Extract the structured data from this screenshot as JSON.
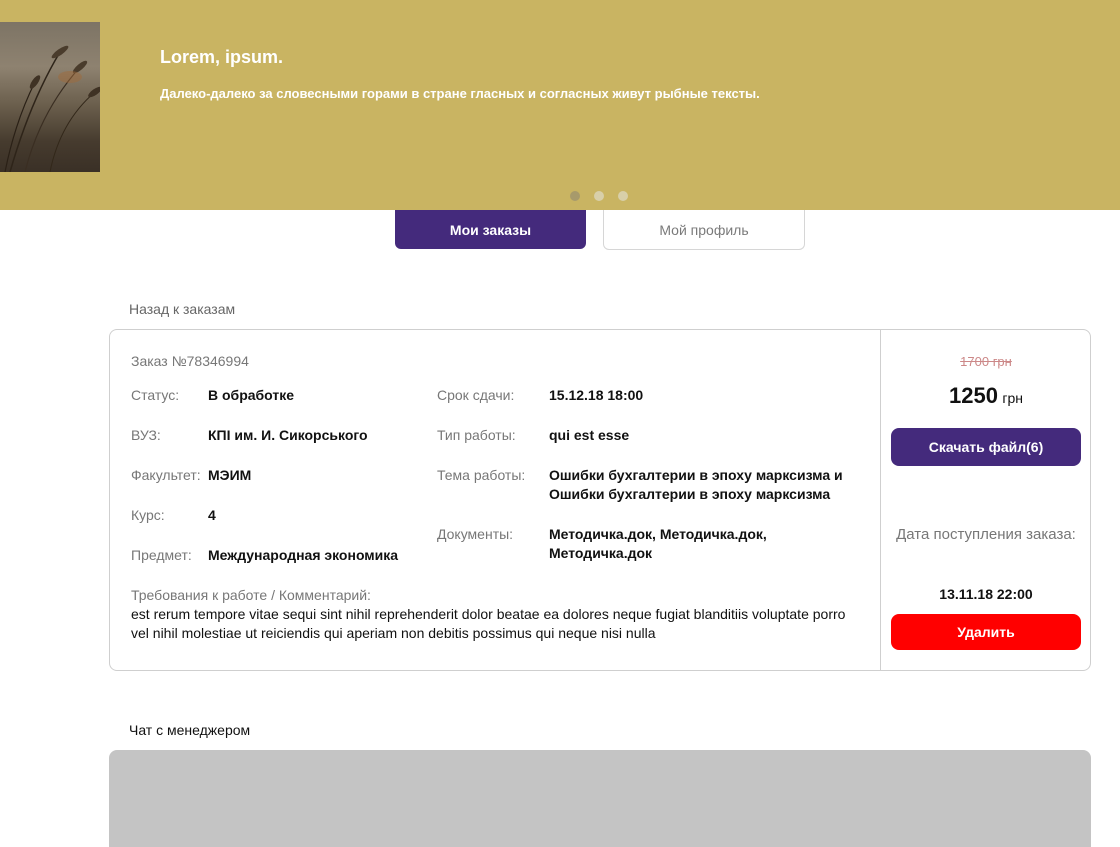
{
  "banner": {
    "title": "Lorem, ipsum.",
    "text": "Далеко-далеко за словесными горами в стране гласных и согласных живут рыбные тексты.",
    "color": "#c9b462",
    "slides": 3,
    "active_slide": 1
  },
  "tabs": {
    "orders": "Мои заказы",
    "profile": "Мой профиль"
  },
  "back_link": "Назад к заказам",
  "order": {
    "number": "Заказ №78346994",
    "left_fields": [
      {
        "label": "Статус:",
        "value": "В обработке"
      },
      {
        "label": "ВУЗ:",
        "value": "КПІ им. И. Сикорського"
      },
      {
        "label": "Факультет:",
        "value": "МЭИМ"
      },
      {
        "label": "Курс:",
        "value": "4"
      },
      {
        "label": "Предмет:",
        "value": "Международная экономика"
      }
    ],
    "right_fields": [
      {
        "label": "Срок сдачи:",
        "value": "15.12.18 18:00"
      },
      {
        "label": "Тип работы:",
        "value": "qui est esse"
      },
      {
        "label": "Тема работы:",
        "value": "Ошибки бухгалтерии в эпоху марксизма и Ошибки бухгалтерии в эпоху марксизма"
      },
      {
        "label": "Документы:",
        "value": "Методичка.док, Методичка.док, Методичка.док"
      }
    ],
    "requirements_label": "Требования к работе / Комментарий:",
    "requirements_text": "est rerum tempore vitae sequi sint nihil reprehenderit dolor beatae ea dolores neque fugiat blanditiis voluptate porro vel nihil molestiae ut reiciendis qui aperiam non debitis possimus qui neque nisi nulla",
    "old_price": "1700 грн",
    "new_price": "1250",
    "currency": "грн",
    "download_button": "Скачать файл(6)",
    "date_label": "Дата поступления заказа:",
    "date_value": "13.11.18 22:00",
    "delete_button": "Удалить"
  },
  "chat": {
    "title": "Чат с менеджером"
  },
  "colors": {
    "accent": "#442a7c",
    "danger": "#ff0000",
    "banner": "#c9b462"
  }
}
